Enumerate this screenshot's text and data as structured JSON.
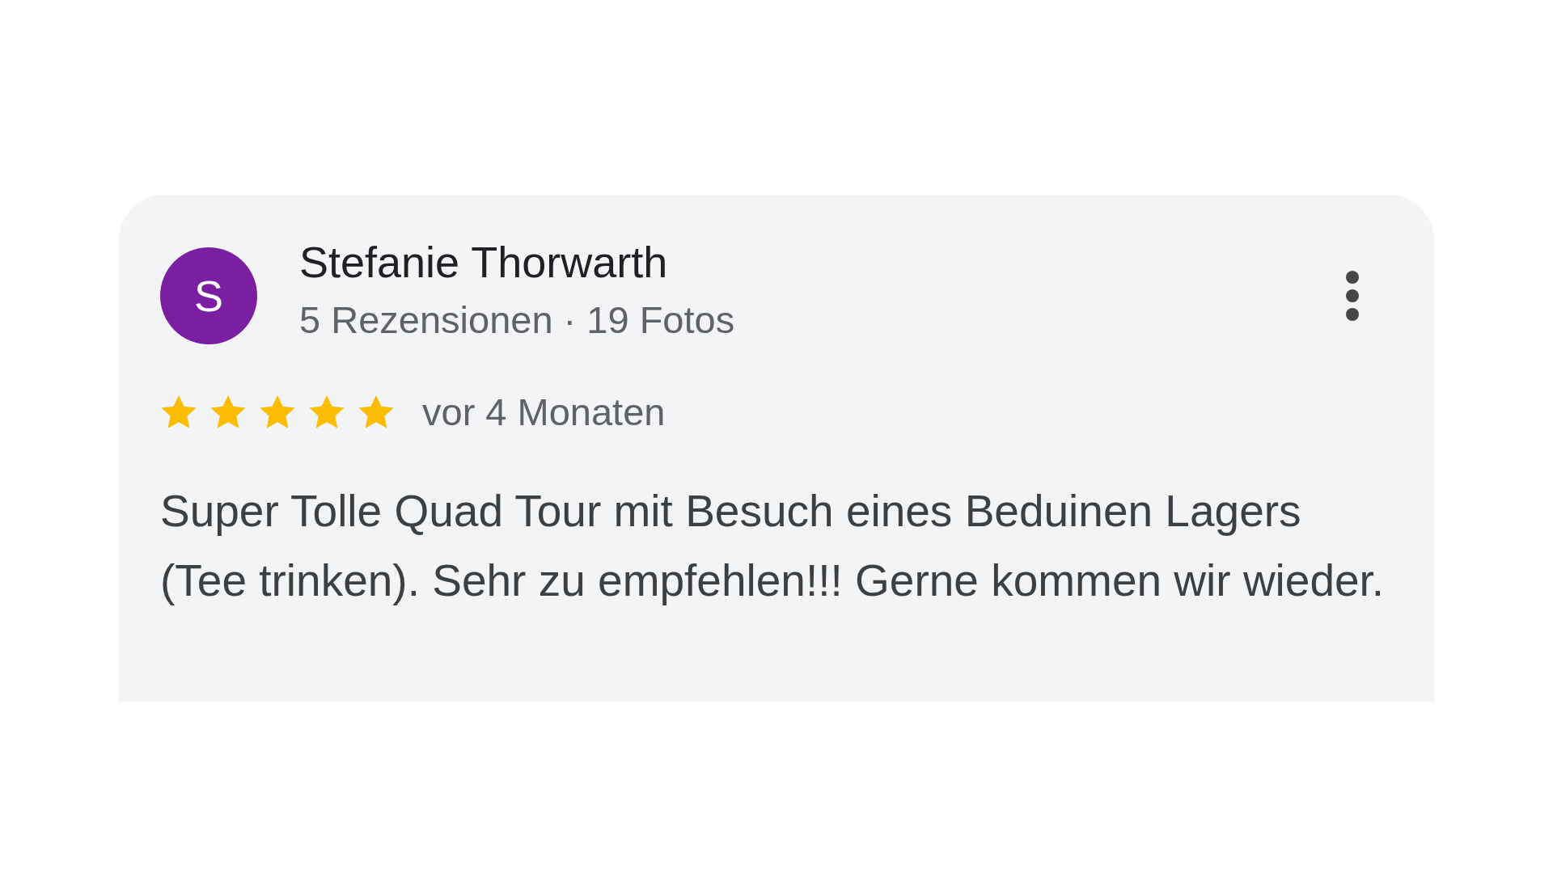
{
  "review": {
    "avatar_letter": "S",
    "author": "Stefanie Thorwarth",
    "author_info": "5 Rezensionen · 19 Fotos",
    "stars": 5,
    "time": "vor 4 Monaten",
    "text": "Super Tolle Quad Tour mit Besuch eines Beduinen Lagers (Tee trinken). Sehr zu empfehlen!!! Gerne kommen wir wieder."
  }
}
